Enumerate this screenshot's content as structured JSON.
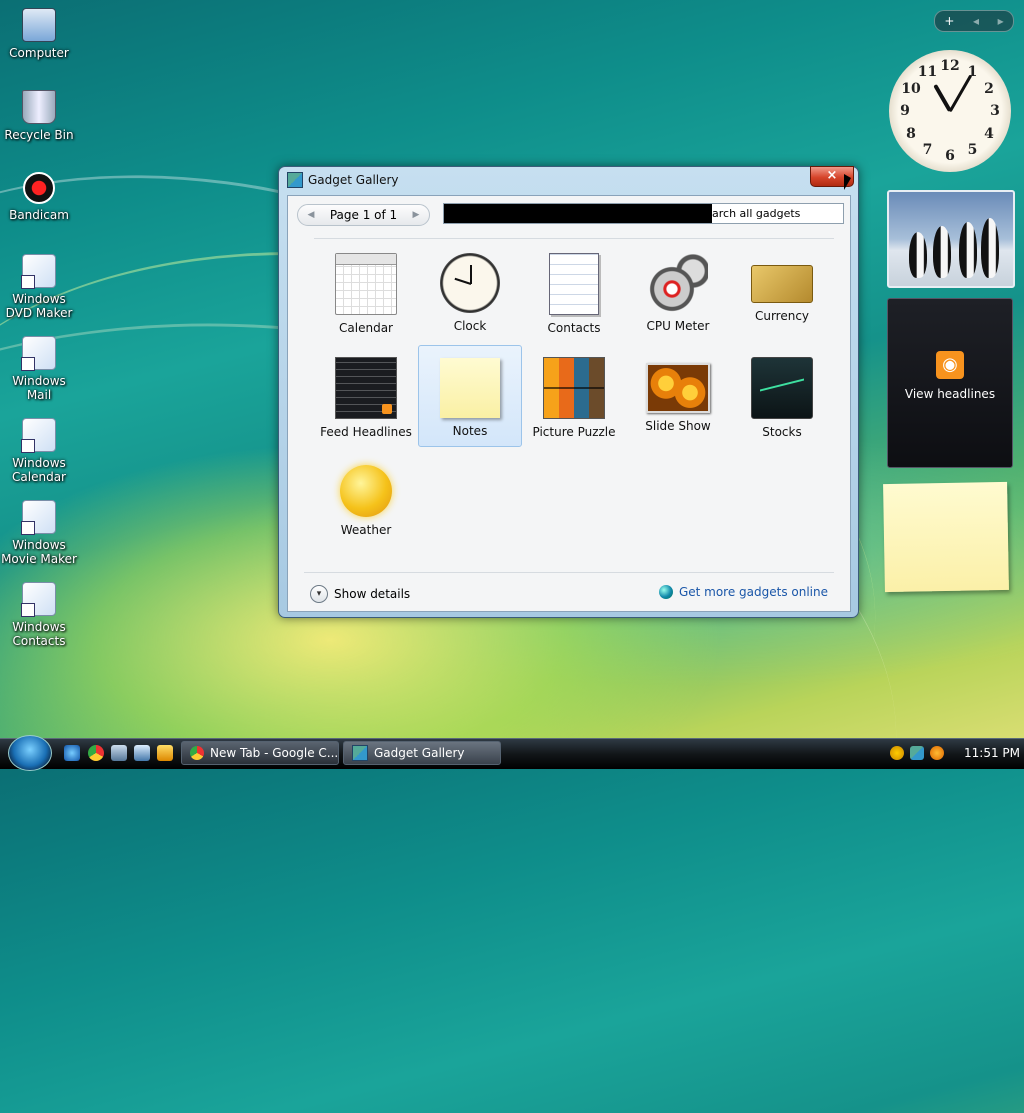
{
  "desktop": {
    "icons": [
      {
        "label": "Computer"
      },
      {
        "label": "Recycle Bin"
      },
      {
        "label": "Bandicam"
      },
      {
        "label": "Windows DVD Maker"
      },
      {
        "label": "Windows Mail"
      },
      {
        "label": "Windows Calendar"
      },
      {
        "label": "Windows Movie Maker"
      },
      {
        "label": "Windows Contacts"
      }
    ]
  },
  "sidebar": {
    "controls": {
      "add": "+",
      "prev": "◂",
      "next": "▸"
    },
    "clock_numbers": [
      "12",
      "1",
      "2",
      "3",
      "4",
      "5",
      "6",
      "7",
      "8",
      "9",
      "10",
      "11"
    ],
    "feed_label": "View headlines"
  },
  "gallery": {
    "title": "Gadget Gallery",
    "close": "×",
    "pager": {
      "label": "Page 1 of 1",
      "prev": "◀",
      "next": "▶"
    },
    "search_text": "arch all gadgets",
    "gadgets": [
      {
        "label": "Calendar"
      },
      {
        "label": "Clock"
      },
      {
        "label": "Contacts"
      },
      {
        "label": "CPU Meter"
      },
      {
        "label": "Currency"
      },
      {
        "label": "Feed Headlines"
      },
      {
        "label": "Notes"
      },
      {
        "label": "Picture Puzzle"
      },
      {
        "label": "Slide Show"
      },
      {
        "label": "Stocks"
      },
      {
        "label": "Weather"
      }
    ],
    "selected": "Notes",
    "show_details": "Show details",
    "more_online": "Get more gadgets online"
  },
  "taskbar": {
    "tasks": [
      {
        "label": "New Tab - Google C..."
      },
      {
        "label": "Gadget Gallery"
      }
    ],
    "time": "11:51 PM"
  },
  "colors": {
    "accent": "#1a56a8",
    "selection": "#d3e6fa",
    "close": "#d6442a"
  }
}
